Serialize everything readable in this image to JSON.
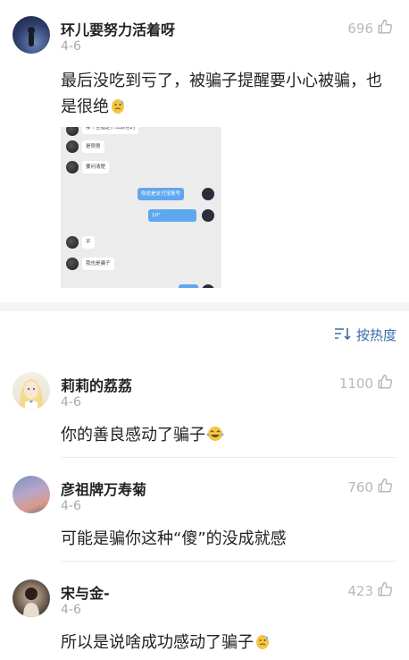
{
  "comments_top": {
    "name": "环儿要努力活着呀",
    "date": "4-6",
    "likes": "696",
    "text": "最后没吃到亏了，被骗子提醒要小心被骗，也是很绝",
    "chat_image": {
      "messages": [
        "哪个主播是什么颜色的",
        "是很傻",
        "要问清楚",
        "你这是支付宝账号",
        "10°",
        "不",
        "我也是骗子"
      ]
    }
  },
  "sort_label": "按热度",
  "comments": [
    {
      "name": "莉莉的荔荔",
      "date": "4-6",
      "likes": "1100",
      "text": "你的善良感动了骗子"
    },
    {
      "name": "彦祖牌万寿菊",
      "date": "4-6",
      "likes": "760",
      "text": "可能是骗你这种“傻”的没成就感"
    },
    {
      "name": "宋与金-",
      "date": "4-6",
      "likes": "423",
      "text": "所以是说啥成功感动了骗子"
    }
  ],
  "icons": {
    "like": "thumbs-up-outline-icon",
    "sort": "sort-icon",
    "emoji_sweat": "sweat-emoji",
    "emoji_laugh": "laugh-cry-emoji"
  },
  "colors": {
    "accent": "#3b6ea8",
    "muted": "#aaaaaa",
    "chat_bubble_blue": "#5fa8ef"
  }
}
